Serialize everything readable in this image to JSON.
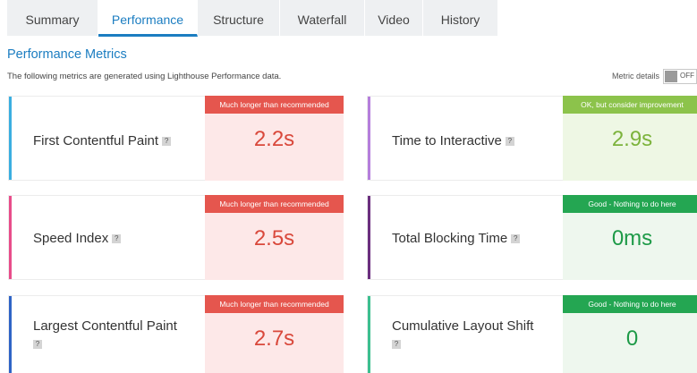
{
  "tabs": [
    {
      "label": "Summary",
      "active": false
    },
    {
      "label": "Performance",
      "active": true
    },
    {
      "label": "Structure",
      "active": false
    },
    {
      "label": "Waterfall",
      "active": false
    },
    {
      "label": "Video",
      "active": false
    },
    {
      "label": "History",
      "active": false
    }
  ],
  "section": {
    "title": "Performance Metrics",
    "description": "The following metrics are generated using Lighthouse Performance data."
  },
  "metric_details": {
    "label": "Metric details",
    "toggle_text": "OFF"
  },
  "help_glyph": "?",
  "metrics": [
    {
      "name": "First Contentful Paint",
      "badge": "Much longer than recommended",
      "value": "2.2s",
      "status": "bad",
      "stripe_color": "#3aaee0"
    },
    {
      "name": "Time to Interactive",
      "badge": "OK, but consider improvement",
      "value": "2.9s",
      "status": "ok",
      "stripe_color": "#b57edc"
    },
    {
      "name": "Speed Index",
      "badge": "Much longer than recommended",
      "value": "2.5s",
      "status": "bad",
      "stripe_color": "#e84c8a"
    },
    {
      "name": "Total Blocking Time",
      "badge": "Good - Nothing to do here",
      "value": "0ms",
      "status": "good",
      "stripe_color": "#6b2f7e"
    },
    {
      "name": "Largest Contentful Paint",
      "badge": "Much longer than recommended",
      "value": "2.7s",
      "status": "bad",
      "stripe_color": "#2f64c6"
    },
    {
      "name": "Cumulative Layout Shift",
      "badge": "Good - Nothing to do here",
      "value": "0",
      "status": "good",
      "stripe_color": "#3cbf8f"
    }
  ]
}
